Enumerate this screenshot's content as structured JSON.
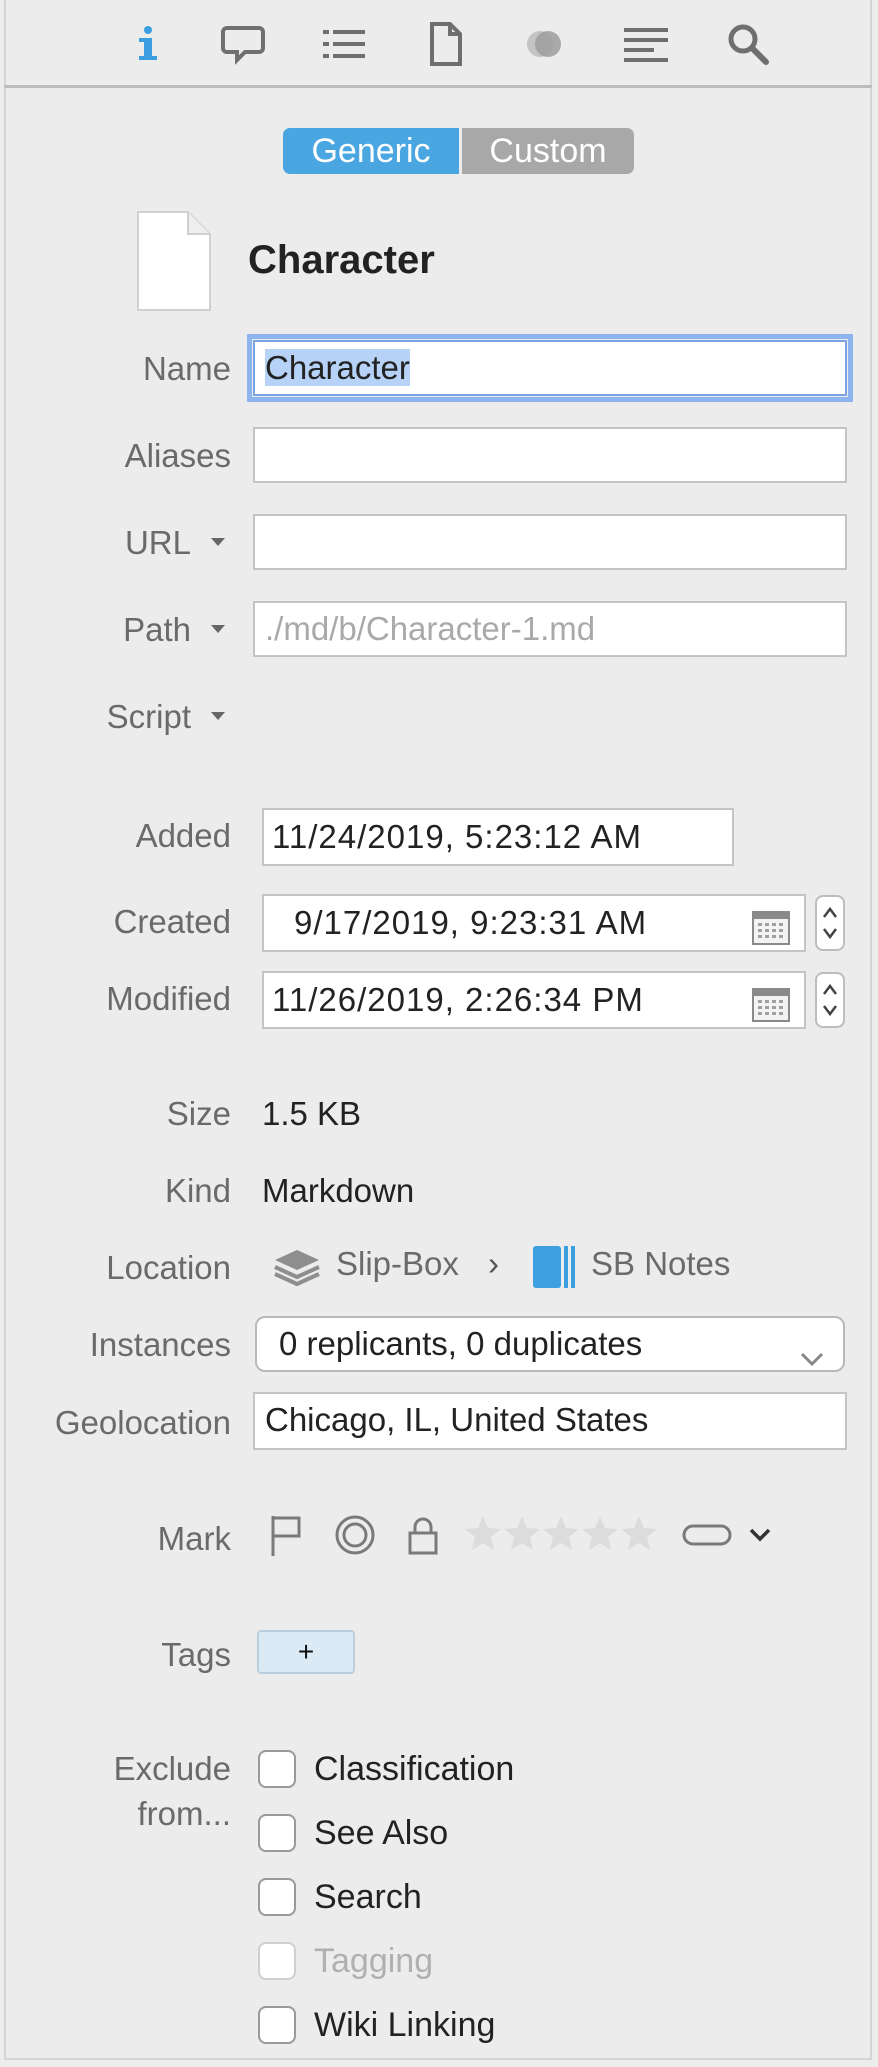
{
  "toolbar": {
    "icons": [
      "info-icon",
      "comment-icon",
      "list-icon",
      "document-icon",
      "annotation-icon",
      "lines-icon",
      "search-icon"
    ]
  },
  "segmented": {
    "generic": "Generic",
    "custom": "Custom"
  },
  "record": {
    "title": "Character"
  },
  "fields": {
    "name_label": "Name",
    "name_value": "Character",
    "aliases_label": "Aliases",
    "aliases_value": "",
    "url_label": "URL",
    "url_value": "",
    "path_label": "Path",
    "path_placeholder": "./md/b/Character-1.md",
    "script_label": "Script"
  },
  "dates": {
    "added_label": "Added",
    "added_value": "11/24/2019,   5:23:12 AM",
    "created_label": "Created",
    "created_value": "9/17/2019,   9:23:31 AM",
    "modified_label": "Modified",
    "modified_value": "11/26/2019,   2:26:34 PM"
  },
  "info": {
    "size_label": "Size",
    "size_value": "1.5 KB",
    "kind_label": "Kind",
    "kind_value": "Markdown",
    "location_label": "Location",
    "location_db": "Slip-Box",
    "location_sep": "›",
    "location_group": "SB Notes",
    "instances_label": "Instances",
    "instances_value": "0 replicants, 0 duplicates",
    "geolocation_label": "Geolocation",
    "geolocation_value": "Chicago, IL, United States"
  },
  "mark": {
    "label": "Mark",
    "rating": 0,
    "max_rating": 5
  },
  "tags": {
    "label": "Tags",
    "add": "+"
  },
  "exclude": {
    "label_line1": "Exclude",
    "label_line2": "from...",
    "options": [
      {
        "label": "Classification",
        "checked": false,
        "disabled": false
      },
      {
        "label": "See Also",
        "checked": false,
        "disabled": false
      },
      {
        "label": "Search",
        "checked": false,
        "disabled": false
      },
      {
        "label": "Tagging",
        "checked": false,
        "disabled": true
      },
      {
        "label": "Wiki Linking",
        "checked": false,
        "disabled": false
      }
    ]
  },
  "colors": {
    "accent": "#4aa6e0",
    "segment_inactive": "#a8a8a8",
    "focus_ring": "#8eb4ef",
    "tag_bg": "#dbeaf5"
  }
}
